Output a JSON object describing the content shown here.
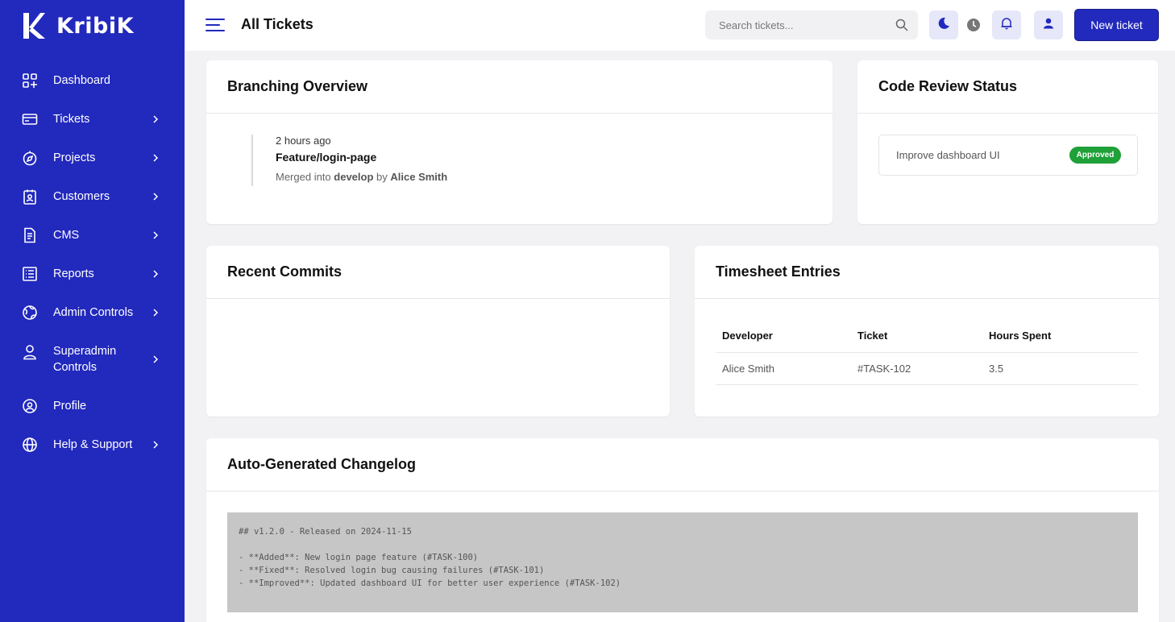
{
  "brand": {
    "name": "KribiK"
  },
  "sidebar": {
    "items": [
      {
        "label": "Dashboard",
        "icon": "grid-icon",
        "chevron": false
      },
      {
        "label": "Tickets",
        "icon": "ticket-icon",
        "chevron": true
      },
      {
        "label": "Projects",
        "icon": "compass-icon",
        "chevron": true
      },
      {
        "label": "Customers",
        "icon": "contact-card-icon",
        "chevron": true
      },
      {
        "label": "CMS",
        "icon": "document-icon",
        "chevron": true
      },
      {
        "label": "Reports",
        "icon": "list-icon",
        "chevron": true
      },
      {
        "label": "Admin Controls",
        "icon": "globe-icon",
        "chevron": true
      },
      {
        "label": "Superadmin Controls",
        "icon": "user-icon",
        "chevron": true
      },
      {
        "label": "Profile",
        "icon": "profile-globe-icon",
        "chevron": false
      },
      {
        "label": "Help & Support",
        "icon": "support-globe-icon",
        "chevron": true
      }
    ]
  },
  "header": {
    "title": "All Tickets",
    "search_placeholder": "Search tickets...",
    "new_ticket_label": "New ticket"
  },
  "branching": {
    "title": "Branching Overview",
    "time": "2 hours ago",
    "branch": "Feature/login-page",
    "merged_prefix": "Merged into",
    "target_branch": "develop",
    "by_text": "by",
    "author": "Alice Smith"
  },
  "code_review": {
    "title": "Code Review Status",
    "item": "Improve dashboard UI",
    "status": "Approved"
  },
  "recent_commits": {
    "title": "Recent Commits"
  },
  "timesheet": {
    "title": "Timesheet Entries",
    "columns": [
      "Developer",
      "Ticket",
      "Hours Spent"
    ],
    "rows": [
      [
        "Alice Smith",
        "#TASK-102",
        "3.5"
      ]
    ]
  },
  "changelog": {
    "title": "Auto-Generated Changelog",
    "lines": [
      "## v1.2.0 - Released on 2024-11-15",
      "",
      "- **Added**: New login page feature (#TASK-100)",
      "- **Fixed**: Resolved login bug causing failures (#TASK-101)",
      "- **Improved**: Updated dashboard UI for better user experience (#TASK-102)"
    ]
  },
  "colors": {
    "sidebar_bg": "#2229bd",
    "accent": "#2229bd",
    "approved_badge": "#1fa038",
    "changelog_bg": "#c6c6c6"
  }
}
